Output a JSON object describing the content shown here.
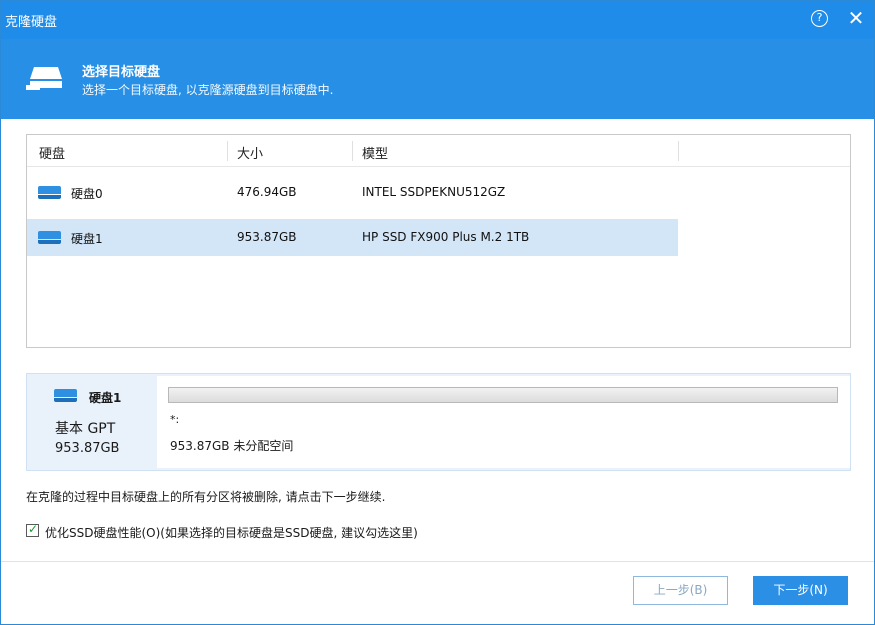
{
  "window": {
    "title": "克隆硬盘",
    "help_glyph": "?",
    "close_glyph": "✕"
  },
  "header": {
    "title": "选择目标硬盘",
    "subtitle": "选择一个目标硬盘, 以克隆源硬盘到目标硬盘中."
  },
  "table": {
    "columns": [
      "硬盘",
      "大小",
      "模型"
    ],
    "rows": [
      {
        "name": "硬盘0",
        "size": "476.94GB",
        "model": "INTEL SSDPEKNU512GZ",
        "selected": false
      },
      {
        "name": "硬盘1",
        "size": "953.87GB",
        "model": "HP SSD FX900 Plus M.2 1TB",
        "selected": true
      }
    ]
  },
  "disk_map": {
    "disk_name": "硬盘1",
    "disk_type": "基本 GPT",
    "disk_size": "953.87GB",
    "partition_label": "*:",
    "partition_desc": "953.87GB 未分配空间"
  },
  "warning": "在克隆的过程中目标硬盘上的所有分区将被删除, 请点击下一步继续.",
  "option": {
    "checked": true,
    "label": "优化SSD硬盘性能(O)(如果选择的目标硬盘是SSD硬盘, 建议勾选这里)"
  },
  "buttons": {
    "prev": "上一步(B)",
    "next": "下一步(N)"
  },
  "colors": {
    "accent": "#1e8ce8",
    "banner": "#2790e6",
    "selected_row": "#d3e6f8",
    "check": "#1a9a2e"
  }
}
